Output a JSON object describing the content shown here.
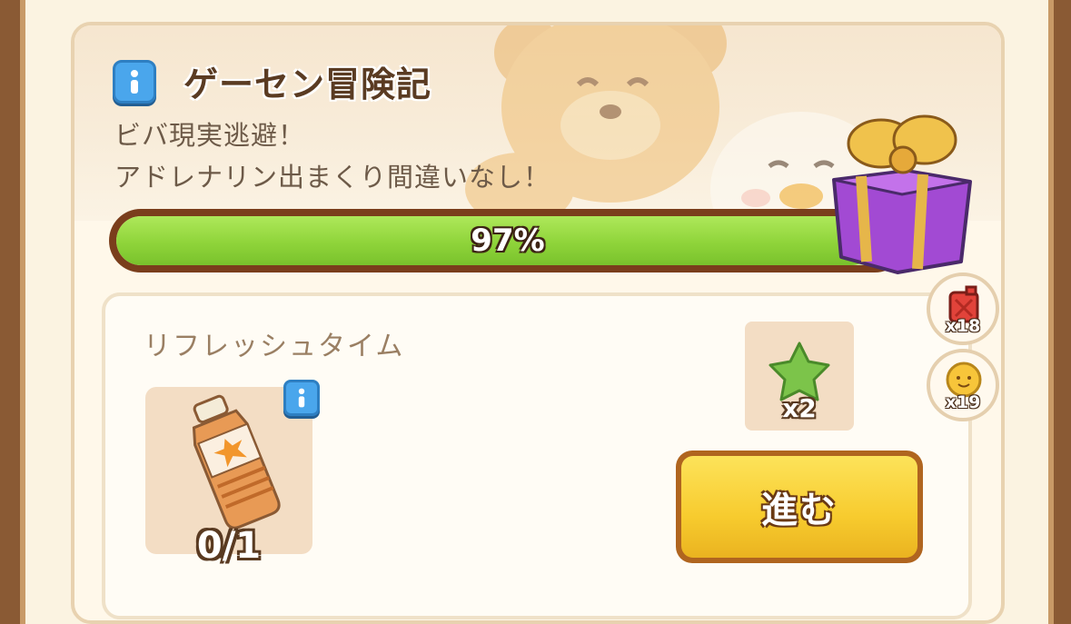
{
  "event": {
    "title": "ゲーセン冒険記",
    "description_lines": [
      "ビバ現実逃避！",
      "アドレナリン出まくり間違いなし！"
    ]
  },
  "progress": {
    "percent": 97,
    "label": "97%"
  },
  "task": {
    "name": "リフレッシュタイム",
    "required_item": {
      "icon": "energy-drink-bottle-icon",
      "count": "0/1"
    },
    "reward": {
      "icon": "green-star-icon",
      "count": "x2"
    },
    "go_button_label": "進む"
  },
  "side_resources": [
    {
      "icon": "red-fuel-can-icon",
      "count": "x18"
    },
    {
      "icon": "sun-face-icon",
      "count": "x19"
    }
  ],
  "colors": {
    "progress_fill": "#8fd43a",
    "button_yellow": "#f7cb2e",
    "info_blue": "#4aa6ec",
    "title_brown": "#5a3b22"
  }
}
